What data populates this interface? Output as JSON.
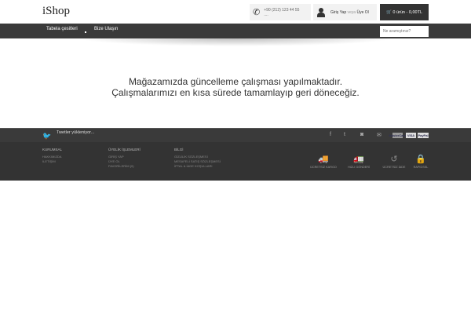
{
  "header": {
    "logo": "iShop",
    "phone": "+90 (212) 123 44 55",
    "phone_sub": "....",
    "login": "Giriş Yap",
    "login_or": "veya",
    "register": "Üye Ol",
    "cart": "0 ürün - 0,00TL"
  },
  "nav": {
    "items": [
      "Tabela çesitleri",
      "Bize Ulaşın"
    ],
    "search_placeholder": "Ne aramıştınız?"
  },
  "main": {
    "line1": "Mağazamızda güncelleme çalışması yapılmaktadır.",
    "line2": "Çalışmalarımızı en kısa sürede tamamlayıp geri döneceğiz."
  },
  "footer": {
    "tweets": "Twetler yükleniyor...",
    "payments": [
      "MasterCard",
      "VISA",
      "PayPal"
    ],
    "columns": [
      {
        "title": "KURUMSAL",
        "links": [
          "HAKKIMIZDA",
          "İLETİŞİM"
        ]
      },
      {
        "title": "ÜYELİK İŞLEMLERİ",
        "links": [
          "GİRİŞ YAP",
          "ÜYE OL",
          "FAVORİLERİM (0)"
        ]
      },
      {
        "title": "BİLGİ",
        "links": [
          "GİZLİLİK SÖZLEŞMESİ",
          "MESAFELİ SATIŞ SÖZLEŞMESİ",
          "İPTAL & İADE KOŞULLARI"
        ]
      }
    ],
    "badges": [
      "ÜCRETSİZ KARGO",
      "HIZLI GÖNDERİ",
      "ÜCRETSİZ İADE",
      "RAPIDSSL"
    ]
  }
}
